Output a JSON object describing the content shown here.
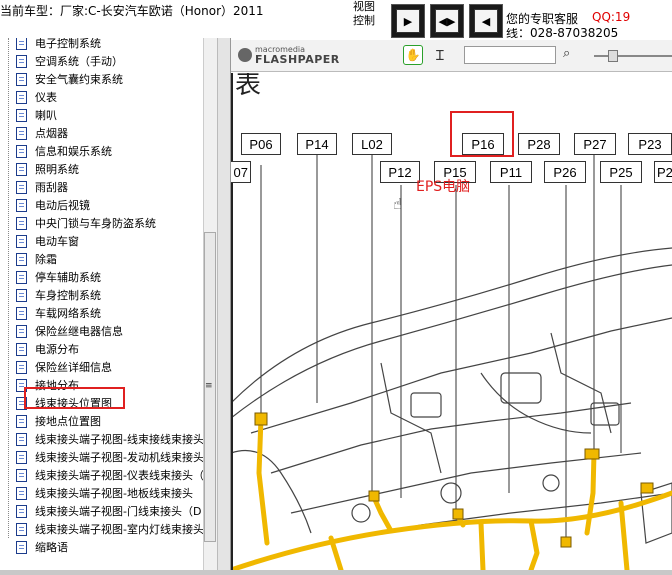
{
  "topbar": {
    "car_label": "当前车型：厂家:C-长安汽车欧诺（Honor）2011",
    "view_control": "视图\n控制",
    "nav_buttons": [
      "▶",
      "◀▶",
      "◀"
    ],
    "service_label": "您的专职客服",
    "qq": "QQ:19",
    "phone": "线：028-87038205"
  },
  "tree": {
    "items": [
      {
        "label": "电子控制系统"
      },
      {
        "label": "空调系统（手动）"
      },
      {
        "label": "安全气囊约束系统"
      },
      {
        "label": "仪表"
      },
      {
        "label": "喇叭"
      },
      {
        "label": "点烟器"
      },
      {
        "label": "信息和娱乐系统"
      },
      {
        "label": "照明系统"
      },
      {
        "label": "雨刮器"
      },
      {
        "label": "电动后视镜"
      },
      {
        "label": "中央门锁与车身防盗系统"
      },
      {
        "label": "电动车窗"
      },
      {
        "label": "除霜"
      },
      {
        "label": "停车辅助系统"
      },
      {
        "label": "车身控制系统"
      },
      {
        "label": "车载网络系统"
      },
      {
        "label": "保险丝继电器信息"
      },
      {
        "label": "电源分布"
      },
      {
        "label": "保险丝详细信息"
      },
      {
        "label": "接地分布"
      },
      {
        "label": "线束接头位置图"
      },
      {
        "label": "接地点位置图"
      },
      {
        "label": "线束接头端子视图-线束接线束接头"
      },
      {
        "label": "线束接头端子视图-发动机线束接头"
      },
      {
        "label": "线束接头端子视图-仪表线束接头（"
      },
      {
        "label": "线束接头端子视图-地板线束接头"
      },
      {
        "label": "线束接头端子视图-门线束接头（D"
      },
      {
        "label": "线束接头端子视图-室内灯线束接头"
      },
      {
        "label": "缩略语"
      }
    ],
    "selected_index": 20
  },
  "viewer": {
    "logo_top": "macromedia",
    "logo": "FLASHPAPER",
    "search_value": "",
    "zoom_level": 0.18
  },
  "diagram": {
    "labels_row1": [
      "P06",
      "P14",
      "L02",
      "P16",
      "P28",
      "P27",
      "P23"
    ],
    "labels_row2": [
      "07",
      "P12",
      "P15",
      "P11",
      "P26",
      "P25",
      "P2"
    ],
    "highlight": "P16",
    "annotation": "EPS电脑"
  },
  "colors": {
    "harness": "#f0b800",
    "highlight": "#e02020",
    "doc_icon": "#1c3c8c"
  }
}
